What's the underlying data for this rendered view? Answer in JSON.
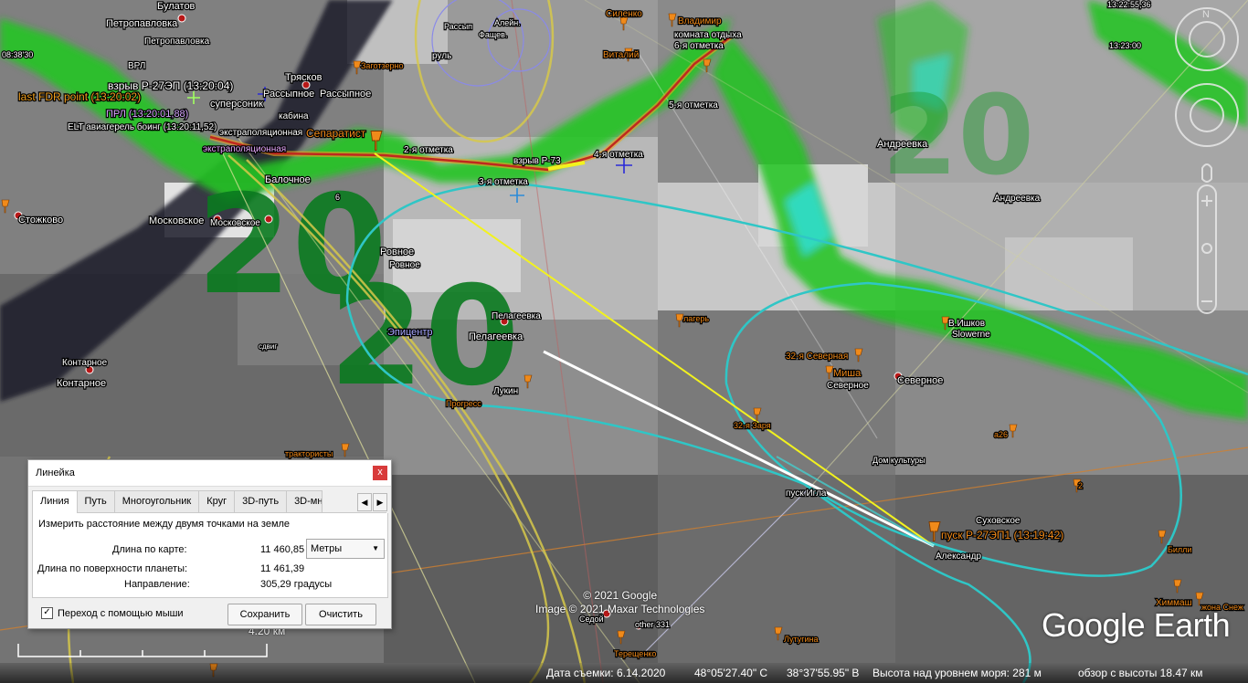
{
  "map": {
    "labels": {
      "bulatov": "Булатов",
      "petropavlovka1": "Петропавловка",
      "petropavlovka2": "Петропавловка",
      "vrl": "ВРЛ",
      "vzryv_r27": "взрыв Р-27ЭП (13:20:04)",
      "last_fdr": "last FDR point (13:20:02)",
      "supersonik": "суперсоник",
      "prl": "ПРЛ (13:20:01,88)",
      "elt": "ELT авиагерель боинг (13:20:11,52)",
      "kabina": "кабина",
      "ekstrapol1": "экстраполяционная",
      "ekstrapol2": "экстраполяционная",
      "separatist": "Сепаратист",
      "zagotzerno": "Заготзерно",
      "tryaskov": "Трясков",
      "rassypnoe1": "Рассыпное",
      "rassypnoe2": "Рассыпное",
      "balochnoe": "Балочное",
      "stozhkovo": "Стожково",
      "moskovskoe1": "Московское",
      "moskovskoe2": "Московское",
      "ravnoe1": "Ровное",
      "ravnoe2": "Ровное",
      "epicentr": "Эпицентр",
      "pelageevka1": "Пелагеевка",
      "pelageevka2": "Пелагеевка",
      "sdvig": "сдвиг",
      "kontarnoe1": "Контарное",
      "kontarnoe2": "Контарное",
      "lukin": "Лукин",
      "progress": "Прогресс",
      "traktoristy": "трактористы",
      "otm2": "2-я отметка",
      "otm3": "3-я отметка",
      "otm4": "4-я отметка",
      "otm5": "5-я отметка",
      "otm6": "6-я отметка",
      "vzryv_r73": "взрыв Р-73",
      "rassyp_small": "Рассып",
      "alein": "Алейн.",
      "fashev": "Фащев.",
      "rul": "руль",
      "silenko": "Силенко",
      "vladimir": "Владимир",
      "komnata": "комната отдыха",
      "vitaliy": "Виталий",
      "andreevka1": "Андреевка",
      "andreevka2": "Андреевка",
      "lager": "лагерь",
      "v_ishkov": "В.Ишков",
      "slowerne": "Slowerne",
      "severnaya32": "32-я Северная",
      "misha": "Миша",
      "severnoe1": "Северное",
      "severnoe2": "Северное",
      "zarya32": "32-я Заря",
      "dom_kultury": "Дом культуры",
      "pusk_igla": "пуск Игла",
      "pusk_r27": "пуск Р-27ЭП1 (13:19:42)",
      "aleksandr": "Александр",
      "suhovskoe": "Суховское",
      "billi": "Билли",
      "himmash": "Химмаш",
      "zhona": "жона Снеж",
      "lutugina": "Лутугина",
      "sedoy": "Седой",
      "other331": "other 331",
      "tereshenko": "Терещенко",
      "a26": "а26",
      "n2": "2",
      "n6": "6",
      "t1": "13:22:55,36",
      "t2": "13:23:00",
      "t3": "08:38'30",
      "big20": "20",
      "big20b": "20",
      "big0": "0",
      "twenty_xx": "20"
    }
  },
  "ruler": {
    "title": "Линейка",
    "close": "x",
    "tabs": [
      "Линия",
      "Путь",
      "Многоугольник",
      "Круг",
      "3D-путь",
      "3D-мн"
    ],
    "description": "Измерить расстояние между двумя точками на земле",
    "map_length_label": "Длина по карте:",
    "map_length_value": "11 460,85",
    "unit": "Метры",
    "surface_length_label": "Длина по поверхности планеты:",
    "surface_length_value": "11 461,39",
    "heading_label": "Направление:",
    "heading_value": "305,29 градусы",
    "mouse_nav_checked": true,
    "mouse_nav_label": "Переход с помощью мыши",
    "save": "Сохранить",
    "clear": "Очистить"
  },
  "scale": {
    "label": "4.20 км"
  },
  "copyright": {
    "line1": "© 2021 Google",
    "line2": "Image © 2021 Maxar Technologies"
  },
  "logo": "Google Earth",
  "status": {
    "capture_date": "Дата съемки: 6.14.2020",
    "lat": "48°05'27.40\" С",
    "lon": "38°37'55.95\" В",
    "elevation": "Высота над уровнем моря:  281 м",
    "eye_alt": "обзор с высоты  18.47 км"
  },
  "colors": {
    "radar_green": "#22c422",
    "radar_dark_green": "#0b7a20",
    "track_red": "#c0281e",
    "cyan_circle": "#2fc6c6",
    "ruler_yellow": "#f2f21e",
    "ruler_white": "#ffffff",
    "pin_orange": "#f08a1a"
  }
}
